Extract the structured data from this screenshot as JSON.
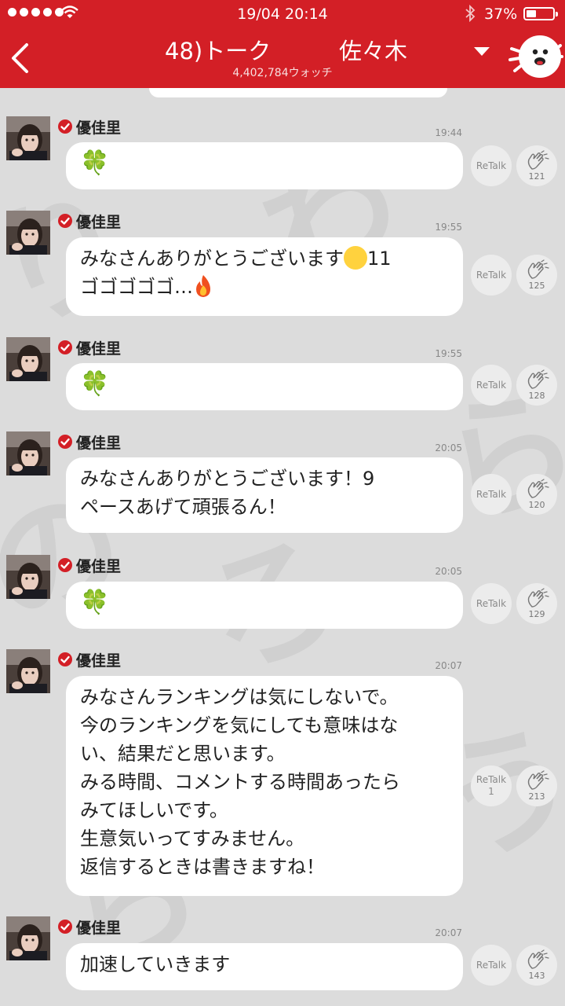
{
  "status_bar": {
    "time": "19/04 20:14",
    "battery_text": "37%",
    "battery_level": 0.37
  },
  "header": {
    "title_left": "48)トーク",
    "title_right": "佐々木",
    "watch_count": "4,402,784ウォッチ"
  },
  "colors": {
    "header_red": "#d31f26",
    "verified_red": "#d31f26"
  },
  "icons": {
    "back": "chevron-left-icon",
    "dropdown": "triangle-down-icon",
    "mascot": "mascot-icon",
    "verified": "verified-check-icon",
    "clap": "clapping-hands-icon"
  },
  "messages": [
    {
      "name": "優佳里",
      "time": "19:44",
      "text": "🍀",
      "retalk": "ReTalk",
      "retalk_count": "",
      "claps": "121"
    },
    {
      "name": "優佳里",
      "time": "19:55",
      "text": "みなさんありがとうございます",
      "text_suffix": "11\nゴゴゴゴゴ…",
      "retalk": "ReTalk",
      "retalk_count": "",
      "claps": "125"
    },
    {
      "name": "優佳里",
      "time": "19:55",
      "text": "🍀",
      "retalk": "ReTalk",
      "retalk_count": "",
      "claps": "128"
    },
    {
      "name": "優佳里",
      "time": "20:05",
      "text": "みなさんありがとうございます！9\nペースあげて頑張るん！",
      "retalk": "ReTalk",
      "retalk_count": "",
      "claps": "120"
    },
    {
      "name": "優佳里",
      "time": "20:05",
      "text": "🍀",
      "retalk": "ReTalk",
      "retalk_count": "",
      "claps": "129"
    },
    {
      "name": "優佳里",
      "time": "20:07",
      "text": "みなさんランキングは気にしないで。\n今のランキングを気にしても意味はな\nい、結果だと思います。\nみる時間、コメントする時間あったら\nみてほしいです。\n生意気いってすみません。\n返信するときは書きますね！",
      "retalk": "ReTalk",
      "retalk_count": "1",
      "claps": "213"
    },
    {
      "name": "優佳里",
      "time": "20:07",
      "text": "加速していきます",
      "retalk": "ReTalk",
      "retalk_count": "",
      "claps": "143"
    }
  ]
}
